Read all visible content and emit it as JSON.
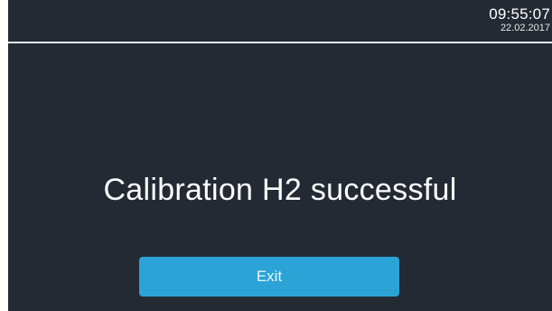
{
  "header": {
    "time": "09:55:07",
    "date": "22.02.2017"
  },
  "main": {
    "message": "Calibration H2 successful"
  },
  "actions": {
    "exit_label": "Exit"
  },
  "colors": {
    "background": "#232a33",
    "accent": "#2ba3d6",
    "text": "#ffffff"
  }
}
